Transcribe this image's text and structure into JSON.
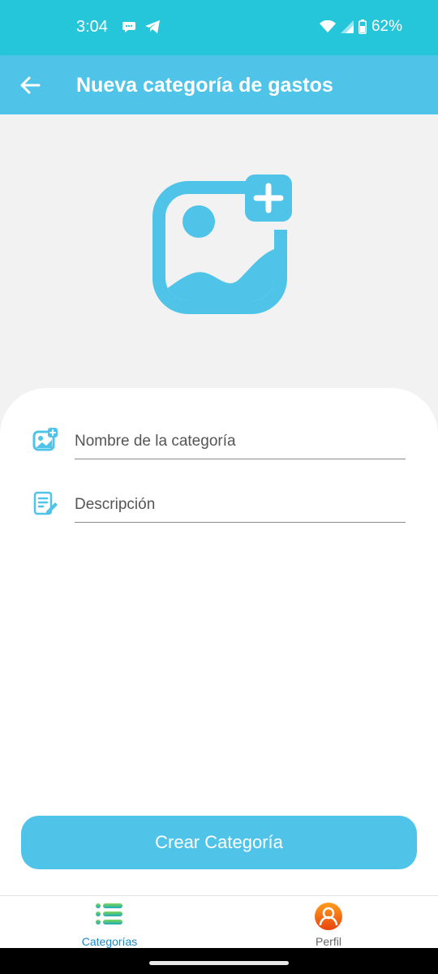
{
  "status_bar": {
    "time": "3:04",
    "battery": "62%",
    "icons": [
      "chat-bubble-icon",
      "telegram-icon",
      "wifi-icon",
      "signal-icon",
      "battery-icon"
    ]
  },
  "app_bar": {
    "title": "Nueva categoría de gastos",
    "back_icon": "arrow-left-icon"
  },
  "hero": {
    "icon": "add-image-icon"
  },
  "form": {
    "name_field": {
      "placeholder": "Nombre de la categoría",
      "value": "",
      "icon": "add-image-icon"
    },
    "description_field": {
      "placeholder": "Descripción",
      "value": "",
      "icon": "edit-document-icon"
    }
  },
  "actions": {
    "create_label": "Crear Categoría"
  },
  "bottom_nav": {
    "items": [
      {
        "label": "Categorías",
        "icon": "list-icon",
        "active": true
      },
      {
        "label": "Perfil",
        "icon": "user-avatar-icon",
        "active": false
      }
    ]
  },
  "colors": {
    "status_bar": "#26c6da",
    "primary": "#4fc3e8",
    "active_nav": "#1e88c8",
    "background": "#f2f2f2"
  }
}
